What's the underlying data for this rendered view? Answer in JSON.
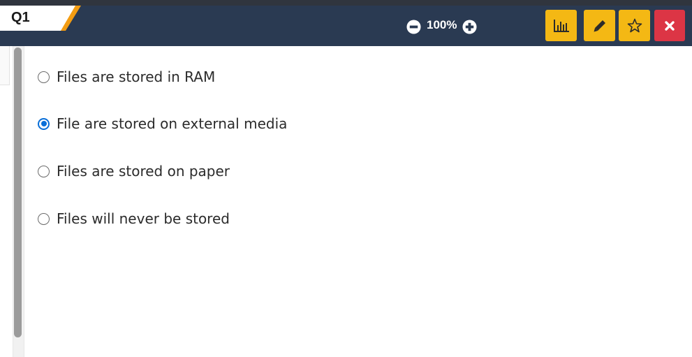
{
  "question": {
    "label": "Q1"
  },
  "zoom": {
    "level": "100%",
    "decrease_icon": "minus-circle-icon",
    "increase_icon": "plus-circle-icon"
  },
  "toolbar": {
    "buttons": [
      {
        "icon": "bar-chart-icon",
        "color": "#f4b814"
      },
      {
        "icon": "pencil-icon",
        "color": "#f4b814"
      },
      {
        "icon": "star-outline-icon",
        "color": "#f4b814"
      },
      {
        "icon": "close-icon",
        "color": "#dc3545"
      }
    ]
  },
  "options": [
    {
      "text": "Files are stored in RAM",
      "selected": false
    },
    {
      "text": "File are stored on external media",
      "selected": true
    },
    {
      "text": "Files are stored on paper",
      "selected": false
    },
    {
      "text": "Files will never be stored",
      "selected": false
    }
  ],
  "colors": {
    "header": "#2a3a52",
    "accent": "#f39c12",
    "selected": "#0a6fd8"
  }
}
